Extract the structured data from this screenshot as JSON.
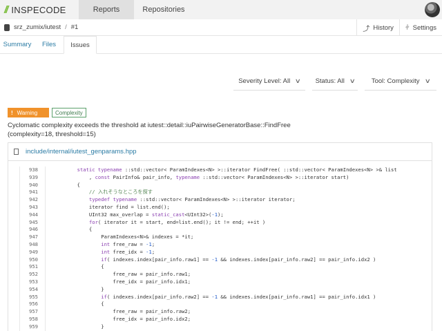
{
  "brand": {
    "logo": "//",
    "name": "INSPECODE"
  },
  "nav": {
    "tabs": [
      {
        "label": "Reports"
      },
      {
        "label": "Repositories"
      }
    ]
  },
  "breadcrumb": {
    "repo": "srz_zumix/iutest",
    "separator": "/",
    "build": "#1"
  },
  "actions": {
    "history": "History",
    "settings": "Settings"
  },
  "subtabs": [
    {
      "label": "Summary"
    },
    {
      "label": "Files"
    },
    {
      "label": "Issues"
    }
  ],
  "filters": {
    "severity": "Severity Level: All",
    "status": "Status: All",
    "tool": "Tool: Complexity"
  },
  "issue": {
    "severity": "Warning",
    "tool": "Complexity",
    "message_line1": "Cyclomatic complexity exceeds the threshold at iutest::detail::iuPairwiseGeneratorBase::FindFree",
    "message_line2": "(complexity=18, threshold=15)",
    "file": "include/internal/iutest_genparams.hpp"
  },
  "colors": {
    "warning": "#f0922b",
    "tool_badge": "#5aa06a",
    "link": "#2a7ba4",
    "keyword": "#8a3fb0",
    "number": "#1a55c8"
  },
  "code": [
    {
      "n": "938",
      "t": "        static typename ::std::vector< ParamIndexes<N> >::iterator FindFree( ::std::vector< ParamIndexes<N> >& list"
    },
    {
      "n": "939",
      "t": "            , const PairInfo& pair_info, typename ::std::vector< ParamIndexes<N> >::iterator start)"
    },
    {
      "n": "940",
      "t": "        {"
    },
    {
      "n": "941",
      "t": "            // 入れそうなところを探す"
    },
    {
      "n": "942",
      "t": "            typedef typename ::std::vector< ParamIndexes<N> >::iterator iterator;"
    },
    {
      "n": "943",
      "t": "            iterator find = list.end();"
    },
    {
      "n": "944",
      "t": "            UInt32 max_overlap = static_cast<UInt32>(-1);"
    },
    {
      "n": "945",
      "t": "            for( iterator it = start, end=list.end(); it != end; ++it )"
    },
    {
      "n": "946",
      "t": "            {"
    },
    {
      "n": "947",
      "t": "                ParamIndexes<N>& indexes = *it;"
    },
    {
      "n": "948",
      "t": "                int free_raw = -1;"
    },
    {
      "n": "949",
      "t": "                int free_idx = -1;"
    },
    {
      "n": "950",
      "t": "                if( indexes.index[pair_info.raw1] == -1 && indexes.index[pair_info.raw2] == pair_info.idx2 )"
    },
    {
      "n": "951",
      "t": "                {"
    },
    {
      "n": "952",
      "t": "                    free_raw = pair_info.raw1;"
    },
    {
      "n": "953",
      "t": "                    free_idx = pair_info.idx1;"
    },
    {
      "n": "954",
      "t": "                }"
    },
    {
      "n": "955",
      "t": "                if( indexes.index[pair_info.raw2] == -1 && indexes.index[pair_info.raw1] == pair_info.idx1 )"
    },
    {
      "n": "956",
      "t": "                {"
    },
    {
      "n": "957",
      "t": "                    free_raw = pair_info.raw2;"
    },
    {
      "n": "958",
      "t": "                    free_idx = pair_info.idx2;"
    },
    {
      "n": "959",
      "t": "                }"
    }
  ]
}
